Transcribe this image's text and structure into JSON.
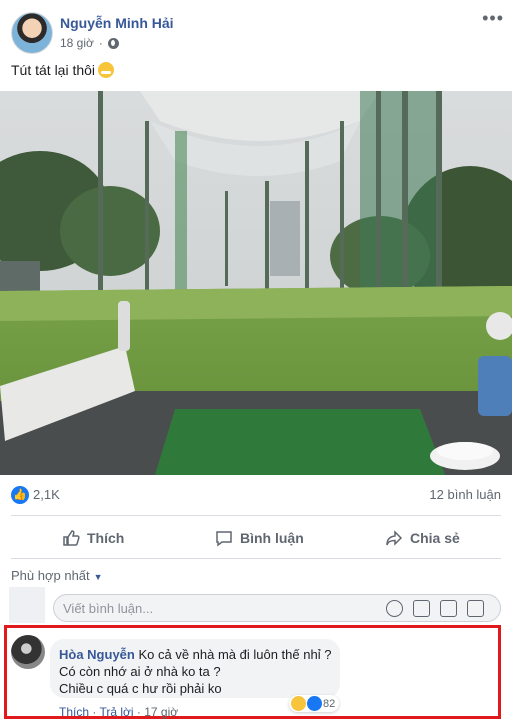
{
  "post": {
    "author": "Nguyễn Minh Hải",
    "time": "18 giờ",
    "privacy_icon": "globe-icon",
    "caption": "Tút tát lại thôi",
    "caption_emoji": "grinning-face-icon"
  },
  "stats": {
    "reactions": "2,1K",
    "comments": "12 bình luận"
  },
  "actions": {
    "like": "Thích",
    "comment": "Bình luận",
    "share": "Chia sẻ"
  },
  "comments_section": {
    "sort_label": "Phù hợp nhất",
    "input_placeholder": "Viết bình luận..."
  },
  "top_comment": {
    "author": "Hòa Nguyễn",
    "line1": "Ko cả về nhà mà đi luôn thế nhỉ ?",
    "line2": "Có còn nhớ ai ở nhà ko ta ?",
    "line3": "Chiều c quá c hư rồi phải ko",
    "reaction_count": "82",
    "like": "Thích",
    "reply": "Trả lời",
    "time": "17 giờ"
  },
  "colors": {
    "link_blue": "#385898",
    "facebook_blue": "#1877f2",
    "highlight_red": "#e0191c"
  }
}
